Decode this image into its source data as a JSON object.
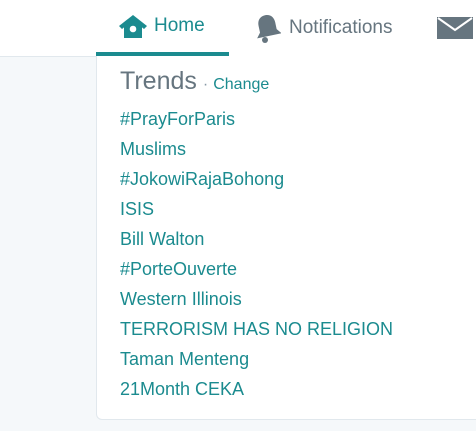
{
  "nav": {
    "home_label": "Home",
    "notifications_label": "Notifications",
    "home_icon": "home-icon",
    "notifications_icon": "bell-icon",
    "messages_icon": "envelope-icon"
  },
  "trends": {
    "title": "Trends",
    "separator": "·",
    "change_label": "Change",
    "items": [
      "#PrayForParis",
      "Muslims",
      "#JokowiRajaBohong",
      "ISIS",
      "Bill Walton",
      "#PorteOuverte",
      "Western Illinois",
      "TERRORISM HAS NO RELIGION",
      "Taman Menteng",
      "21Month CEKA"
    ]
  },
  "colors": {
    "accent": "#1b8b8f",
    "muted": "#66757f",
    "border": "#e1e8ed",
    "background": "#f5f8fa"
  }
}
